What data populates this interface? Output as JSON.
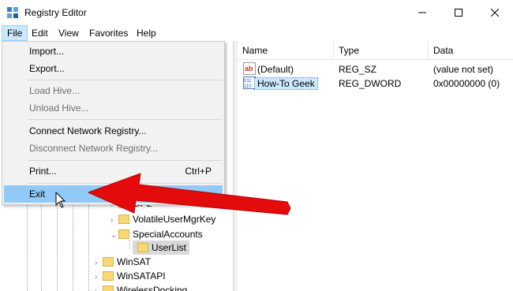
{
  "window": {
    "title": "Registry Editor"
  },
  "menubar": {
    "items": [
      "File",
      "Edit",
      "View",
      "Favorites",
      "Help"
    ],
    "active": "File"
  },
  "file_menu": {
    "import": "Import...",
    "export": "Export...",
    "load_hive": "Load Hive...",
    "unload_hive": "Unload Hive...",
    "connect": "Connect Network Registry...",
    "disconnect": "Disconnect Network Registry...",
    "print": "Print...",
    "print_shortcut": "Ctrl+P",
    "exit": "Exit"
  },
  "tree": {
    "partial": "GPL",
    "items": [
      "VolatileUserMgrKey",
      "SpecialAccounts",
      "UserList",
      "WinSAT",
      "WinSATAPI",
      "WirelessDocking"
    ]
  },
  "values_table": {
    "headers": [
      "Name",
      "Type",
      "Data"
    ],
    "rows": [
      {
        "name": "(Default)",
        "type": "REG_SZ",
        "data": "(value not set)",
        "icon": "string-value-icon"
      },
      {
        "name": "How-To Geek",
        "type": "REG_DWORD",
        "data": "0x00000000 (0)",
        "icon": "dword-value-icon"
      }
    ]
  },
  "colors": {
    "menu_hover": "#91c9f7",
    "selection": "#cce8ff",
    "arrow": "#e30b0b",
    "folder": "#f8d775"
  }
}
